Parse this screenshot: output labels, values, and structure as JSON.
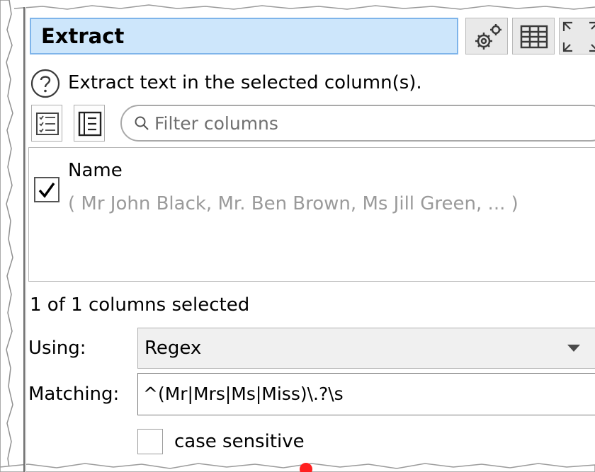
{
  "panel": {
    "title": "Extract",
    "help_text": "Extract text in the selected column(s)."
  },
  "toolbar": {
    "icons": [
      "settings-gears-icon",
      "table-icon",
      "maximize-arrows-icon"
    ]
  },
  "filter": {
    "placeholder": "Filter columns",
    "value": "",
    "icons": [
      "check-list-icon",
      "plain-list-icon",
      "search-icon"
    ]
  },
  "columns": [
    {
      "name": "Name",
      "sample": "( Mr John Black, Mr. Ben Brown, Ms Jill Green, ... )",
      "checked": true
    }
  ],
  "selection": {
    "summary": "1 of 1 columns selected"
  },
  "options": {
    "using_label": "Using:",
    "using_value": "Regex",
    "matching_label": "Matching:",
    "matching_value": "^(Mr|Mrs|Ms|Miss)\\.?\\s",
    "case_sensitive_label": "case sensitive",
    "case_sensitive": false
  },
  "colors": {
    "title_background": "#cde6fb",
    "title_border": "#7eb4ea",
    "sample_text": "#9a9a9a"
  }
}
